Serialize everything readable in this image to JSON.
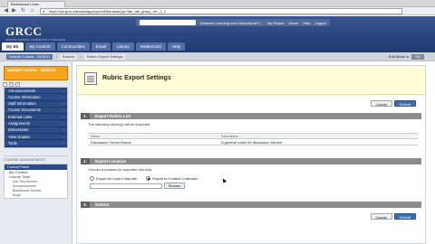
{
  "browser": {
    "tab_title": "Blackboard Learn",
    "url": "https://ssl.grcc.edu/webapps/portal/frameset.jsp?tab_tab_group_id=_2_1"
  },
  "header": {
    "logo": "GRCC",
    "logo_sub": "GRAND RAPIDS COMMUNITY COLLEGE",
    "links": [
      "Distance Learning and Instructional T...",
      "My Places",
      "Home",
      "Help",
      "Logout"
    ],
    "tabs": [
      "My Bb",
      "My Content",
      "Communities",
      "Email",
      "Library",
      "RaiderCard",
      "Help"
    ],
    "active_tab": "My Bb"
  },
  "breadcrumb": {
    "items": [
      "Sample Course - BUS111",
      "Rubrics",
      "Rubric Export Settings"
    ],
    "edit_mode_label": "Edit Mode is:",
    "edit_mode_value": "ON"
  },
  "course_menu": {
    "title": "Sample Course - BUS111",
    "items": [
      "Announcements",
      "Course Information",
      "Staff Information",
      "Course Documents",
      "External Links",
      "Assignments",
      "Discussions",
      "View Grades",
      "Tools"
    ]
  },
  "course_management": {
    "heading": "COURSE MANAGEMENT",
    "control_panel": "Control Panel",
    "content_collection": "My Content",
    "course_tools": "Course Tools",
    "sub_items": [
      "Add Test Student",
      "Announcements",
      "Blackboard Scholar",
      "Blogs"
    ]
  },
  "page": {
    "title": "Rubric Export Settings",
    "cancel": "Cancel",
    "submit": "Submit",
    "step1": {
      "num": "1.",
      "title": "Export Rubric List",
      "desc": "The following rubric(s) will be exported.",
      "col_name": "Name",
      "col_description": "Description",
      "row_name": "Discussion Forum Rubric",
      "row_description": "A general rubric for discussion forums"
    },
    "step2": {
      "num": "2.",
      "title": "Export Location",
      "desc": "Choose a location for exported rubric(s).",
      "option_local": "Export to Local Computer",
      "option_collection": "Export to Content Collection",
      "browse": "Browse"
    },
    "step3": {
      "num": "3.",
      "title": "Submit"
    }
  }
}
